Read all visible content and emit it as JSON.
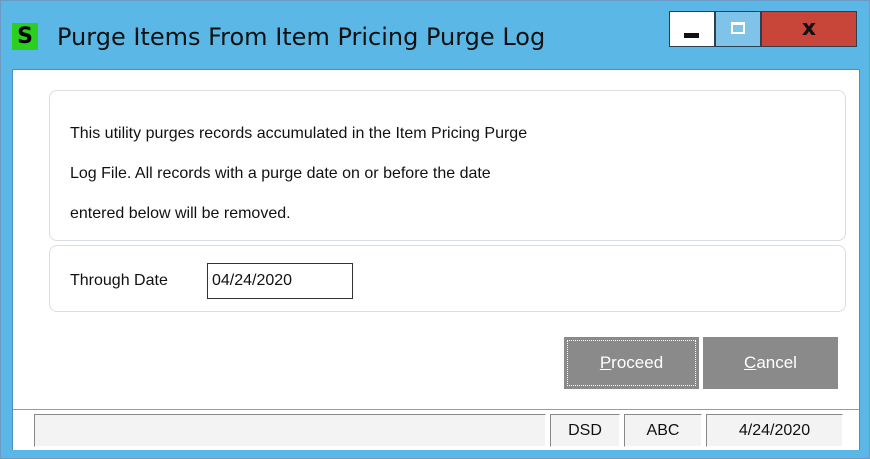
{
  "window": {
    "app_icon_letter": "S",
    "title": "Purge Items From Item Pricing Purge Log",
    "close_glyph": "x"
  },
  "description": {
    "line1": "This utility purges records accumulated in the Item Pricing Purge",
    "line2": "Log File.  All records with a purge date on or before the date",
    "line3": "entered below will be removed."
  },
  "through_date": {
    "label": "Through Date",
    "value": "04/24/2020"
  },
  "buttons": {
    "proceed_hotkey": "P",
    "proceed_rest": "roceed",
    "cancel_hotkey": "C",
    "cancel_rest": "ancel"
  },
  "status_bar": {
    "message": "",
    "company": "DSD",
    "user": "ABC",
    "date": "4/24/2020"
  },
  "colors": {
    "title_bar": "#5bb8e6",
    "close_button": "#c8453a",
    "app_icon": "#2bcf1f",
    "button_bg": "#8a8a8a"
  },
  "icons": [
    "sage-app-icon",
    "minimize-icon",
    "maximize-icon",
    "close-icon"
  ]
}
